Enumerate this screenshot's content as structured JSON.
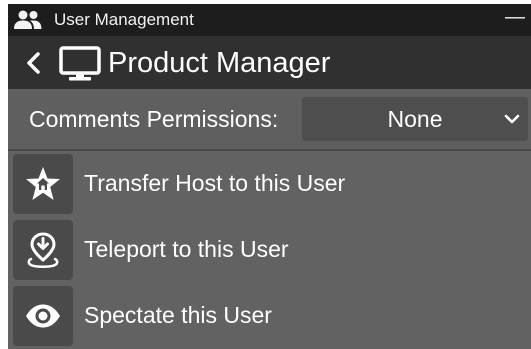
{
  "window": {
    "title": "User Management",
    "title_icon": "people-icon",
    "minimize_label": "—"
  },
  "header": {
    "back_icon": "chevron-left-icon",
    "device_icon": "monitor-icon",
    "title": "Product Manager"
  },
  "permissions": {
    "label": "Comments Permissions:",
    "selected": "None",
    "dropdown_icon": "chevron-down-icon"
  },
  "actions": [
    {
      "label": "Transfer Host to this User",
      "icon": "star-house-icon"
    },
    {
      "label": "Teleport to this User",
      "icon": "location-pin-icon"
    },
    {
      "label": "Spectate this User",
      "icon": "eye-icon"
    }
  ],
  "colors": {
    "panel": "#626262",
    "title_bar": "#1d1d1d",
    "header": "#303030",
    "icon_box": "#4a4a4a",
    "dropdown": "#4e4e4e",
    "text": "#ffffff"
  }
}
